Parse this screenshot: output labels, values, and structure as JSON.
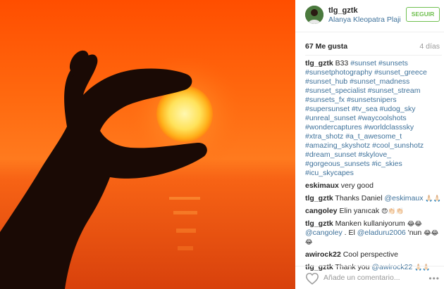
{
  "post": {
    "owner": "tlg_gztk",
    "location": "Alanya Kleopatra Plaji",
    "follow_label": "SEGUIR",
    "likes": "67 Me gusta",
    "time_ago": "4 días"
  },
  "caption": {
    "user": "tlg_gztk",
    "text": "B33",
    "hashtags": [
      "#sunset",
      "#sunsets",
      "#sunsetphotography",
      "#sunset_greece",
      "#sunset_hub",
      "#sunset_madness",
      "#sunset_specialist",
      "#sunset_stream",
      "#sunsets_fx",
      "#sunsetsnipers",
      "#supersunset",
      "#tv_sea",
      "#udog_sky",
      "#unreal_sunset",
      "#waycoolshots",
      "#wondercaptures",
      "#worldclasssky",
      "#xtra_shotz",
      "#a_t_awesome_t",
      "#amazing_skyshotz",
      "#cool_sunshotz",
      "#dream_sunset",
      "#skylove_",
      "#gorgeous_sunsets",
      "#ic_skies",
      "#icu_skycapes"
    ]
  },
  "comments": [
    {
      "user": "eskimaux",
      "text": "very good"
    },
    {
      "user": "tlg_gztk",
      "text": "Thanks Daniel",
      "mention": "@eskimaux",
      "emoji": "🙏🏻🙏🏻"
    },
    {
      "user": "cangoley",
      "text": "Elin yanıcak",
      "emoji": "😍👏🏻👏🏻"
    },
    {
      "user": "tlg_gztk",
      "text": "Manken kullaniyorum",
      "emoji": "😂😂",
      "mention": "@cangoley",
      "text2": ". El",
      "mention2": "@eladuru2006",
      "text3": "'nun",
      "emoji2": "😂😂😂"
    },
    {
      "user": "awirock22",
      "text": "Cool perspective"
    },
    {
      "user": "tlg_gztk",
      "text": "Thank you",
      "mention": "@awirock22",
      "emoji": "🙏🏻🙏🏻"
    }
  ],
  "add_comment": {
    "placeholder": "Añade un comentario..."
  },
  "icons": {
    "like": "heart-outline-icon",
    "more": "more-options-icon"
  },
  "colors": {
    "link": "#3f729b",
    "follow": "#70c050",
    "muted": "#999999"
  }
}
